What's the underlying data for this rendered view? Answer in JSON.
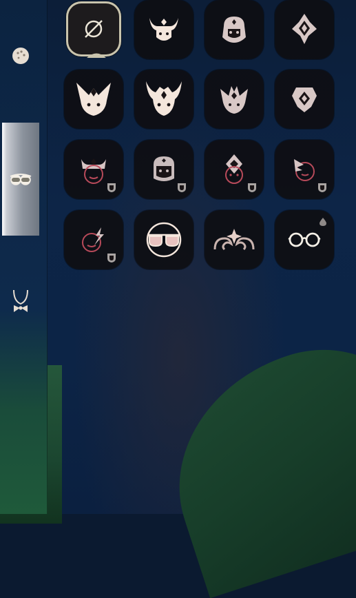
{
  "theme": {
    "icon_color": "#f4e6dc",
    "icon_dim_color": "#e8c8c8",
    "locked_icon_color": "#c77d86",
    "tile_bg": "#0e0e12",
    "selected_border": "#c9c4ad",
    "active_tab_color": "#c9ccd3"
  },
  "sidebar": {
    "tabs": [
      {
        "icon": "hair-bun-icon",
        "active": false
      },
      {
        "icon": "glasses-icon",
        "active": true
      },
      {
        "icon": "bowtie-necklace-icon",
        "active": false
      }
    ]
  },
  "grid": {
    "items": [
      {
        "icon": "none-icon",
        "selected": true,
        "locked": false
      },
      {
        "icon": "horned-mask-icon",
        "selected": false,
        "locked": false
      },
      {
        "icon": "helmet-mask-icon",
        "selected": false,
        "locked": false
      },
      {
        "icon": "diamond-crest-icon",
        "selected": false,
        "locked": false
      },
      {
        "icon": "winged-mask-icon",
        "selected": false,
        "locked": false
      },
      {
        "icon": "horned-crown-mask-icon",
        "selected": false,
        "locked": false
      },
      {
        "icon": "spiked-mask-icon",
        "selected": false,
        "locked": false
      },
      {
        "icon": "gem-crest-icon",
        "selected": false,
        "locked": false
      },
      {
        "icon": "crowned-face-icon",
        "selected": false,
        "locked": true
      },
      {
        "icon": "visor-face-icon",
        "selected": false,
        "locked": true
      },
      {
        "icon": "diamond-face-icon",
        "selected": false,
        "locked": true
      },
      {
        "icon": "flame-face-icon",
        "selected": false,
        "locked": true
      },
      {
        "icon": "bolt-face-icon",
        "selected": false,
        "locked": true
      },
      {
        "icon": "sunglasses-icon",
        "selected": false,
        "locked": false
      },
      {
        "icon": "horn-swirl-icon",
        "selected": false,
        "locked": false
      },
      {
        "icon": "round-glasses-icon",
        "selected": false,
        "locked": false,
        "badge": "drop-icon"
      }
    ]
  }
}
